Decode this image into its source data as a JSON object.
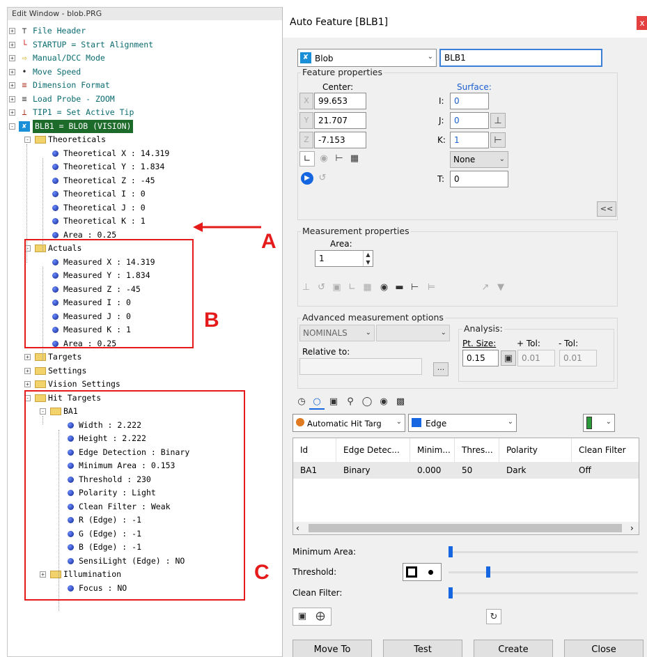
{
  "edit_window": {
    "title": "Edit Window - blob.PRG",
    "nodes": [
      {
        "expander": "+",
        "icon": "file-header-icon",
        "label": "File Header",
        "style": "teal"
      },
      {
        "expander": "+",
        "icon": "alignment-icon",
        "label": "STARTUP = Start Alignment",
        "style": "teal"
      },
      {
        "expander": "+",
        "icon": "manual-dcc-icon",
        "label": "Manual/DCC Mode",
        "style": "teal"
      },
      {
        "expander": "+",
        "icon": "move-speed-icon",
        "label": "Move Speed",
        "style": "teal"
      },
      {
        "expander": "+",
        "icon": "dimension-format-icon",
        "label": "Dimension Format",
        "style": "teal"
      },
      {
        "expander": "+",
        "icon": "load-probe-icon",
        "label": "Load Probe - ZOOM",
        "style": "teal"
      },
      {
        "expander": "+",
        "icon": "set-tip-icon",
        "label": "TIP1 = Set Active Tip",
        "style": "teal"
      },
      {
        "expander": "-",
        "icon": "blob-feature-icon",
        "label": "BLB1 = BLOB (VISION)",
        "style": "selected"
      },
      {
        "expander": "-",
        "icon": "folder-icon",
        "label": "Theoreticals"
      },
      {
        "icon": "property-dot-icon",
        "label": "Theoretical X : 14.319"
      },
      {
        "icon": "property-dot-icon",
        "label": "Theoretical Y : 1.834"
      },
      {
        "icon": "property-dot-icon",
        "label": "Theoretical Z : -45"
      },
      {
        "icon": "property-dot-icon",
        "label": "Theoretical I : 0"
      },
      {
        "icon": "property-dot-icon",
        "label": "Theoretical J : 0"
      },
      {
        "icon": "property-dot-icon",
        "label": "Theoretical K : 1"
      },
      {
        "icon": "property-dot-icon",
        "label": "Area : 0.25"
      },
      {
        "expander": "-",
        "icon": "folder-icon",
        "label": "Actuals"
      },
      {
        "icon": "property-dot-icon",
        "label": "Measured X : 14.319"
      },
      {
        "icon": "property-dot-icon",
        "label": "Measured Y : 1.834"
      },
      {
        "icon": "property-dot-icon",
        "label": "Measured Z : -45"
      },
      {
        "icon": "property-dot-icon",
        "label": "Measured I : 0"
      },
      {
        "icon": "property-dot-icon",
        "label": "Measured J : 0"
      },
      {
        "icon": "property-dot-icon",
        "label": "Measured K : 1"
      },
      {
        "icon": "property-dot-icon",
        "label": "Area : 0.25"
      },
      {
        "expander": "+",
        "icon": "folder-icon",
        "label": "Targets"
      },
      {
        "expander": "+",
        "icon": "folder-icon",
        "label": "Settings"
      },
      {
        "expander": "+",
        "icon": "folder-icon",
        "label": "Vision Settings"
      },
      {
        "expander": "-",
        "icon": "folder-icon",
        "label": "Hit Targets"
      },
      {
        "expander": "-",
        "icon": "folder-icon",
        "label": "BA1"
      },
      {
        "icon": "property-dot-icon",
        "label": "Width : 2.222"
      },
      {
        "icon": "property-dot-icon",
        "label": "Height : 2.222"
      },
      {
        "icon": "property-dot-icon",
        "label": "Edge Detection : Binary"
      },
      {
        "icon": "property-dot-icon",
        "label": "Minimum Area : 0.153"
      },
      {
        "icon": "property-dot-icon",
        "label": "Threshold : 230"
      },
      {
        "icon": "property-dot-icon",
        "label": "Polarity : Light"
      },
      {
        "icon": "property-dot-icon",
        "label": "Clean Filter : Weak"
      },
      {
        "icon": "property-dot-icon",
        "label": "R (Edge) : -1"
      },
      {
        "icon": "property-dot-icon",
        "label": "G (Edge) : -1"
      },
      {
        "icon": "property-dot-icon",
        "label": "B (Edge) : -1"
      },
      {
        "icon": "property-dot-icon",
        "label": "SensiLight (Edge) : NO"
      },
      {
        "expander": "+",
        "icon": "folder-icon",
        "label": "Illumination"
      },
      {
        "icon": "property-dot-icon",
        "label": "Focus : NO"
      }
    ]
  },
  "annotations": {
    "a": "A",
    "b": "B",
    "c": "C",
    "color": "#e51a1a"
  },
  "dialog": {
    "title": "Auto Feature [BLB1]",
    "close_glyph": "x",
    "feature_type": "Blob",
    "feature_name": "BLB1",
    "feature_properties": {
      "title": "Feature properties",
      "center_label": "Center:",
      "surface_label": "Surface:",
      "x_label": "X",
      "x": "99.653",
      "y_label": "Y",
      "y": "21.707",
      "z_label": "Z",
      "z": "-7.153",
      "i_label": "I:",
      "i": "0",
      "j_label": "J:",
      "j": "0",
      "k_label": "K:",
      "k": "1",
      "t_label": "T:",
      "t": "0",
      "none_option": "None",
      "collapse": "<<"
    },
    "measurement_properties": {
      "title": "Measurement properties",
      "area_label": "Area:",
      "area": "1"
    },
    "advanced": {
      "title": "Advanced measurement options",
      "mode": "NOMINALS",
      "relative_to_label": "Relative to:",
      "browse": "...",
      "analysis_label": "Analysis:",
      "pt_size_label": "Pt. Size:",
      "pt_size": "0.15",
      "plus_tol_label": "+ Tol:",
      "plus_tol": "0.01",
      "minus_tol_label": "- Tol:",
      "minus_tol": "0.01"
    },
    "hit_target_type": "Automatic Hit Targ",
    "edge_mode": "Edge",
    "table": {
      "columns": [
        "Id",
        "Edge Detec...",
        "Minim...",
        "Thres...",
        "Polarity",
        "Clean Filter"
      ],
      "rows": [
        [
          "BA1",
          "Binary",
          "0.000",
          "50",
          "Dark",
          "Off"
        ]
      ]
    },
    "sliders": {
      "minimum_area_label": "Minimum Area:",
      "threshold_label": "Threshold:",
      "clean_filter_label": "Clean Filter:",
      "minimum_area_level": 0.0,
      "threshold_level": 0.2,
      "clean_filter_level": 0.0
    },
    "buttons": {
      "move_to": "Move To",
      "test": "Test",
      "create": "Create",
      "close": "Close"
    },
    "colors": {
      "selection": "#1d6b2b",
      "accent": "#1566e0",
      "blob_icon": "#1a8fd8"
    }
  }
}
